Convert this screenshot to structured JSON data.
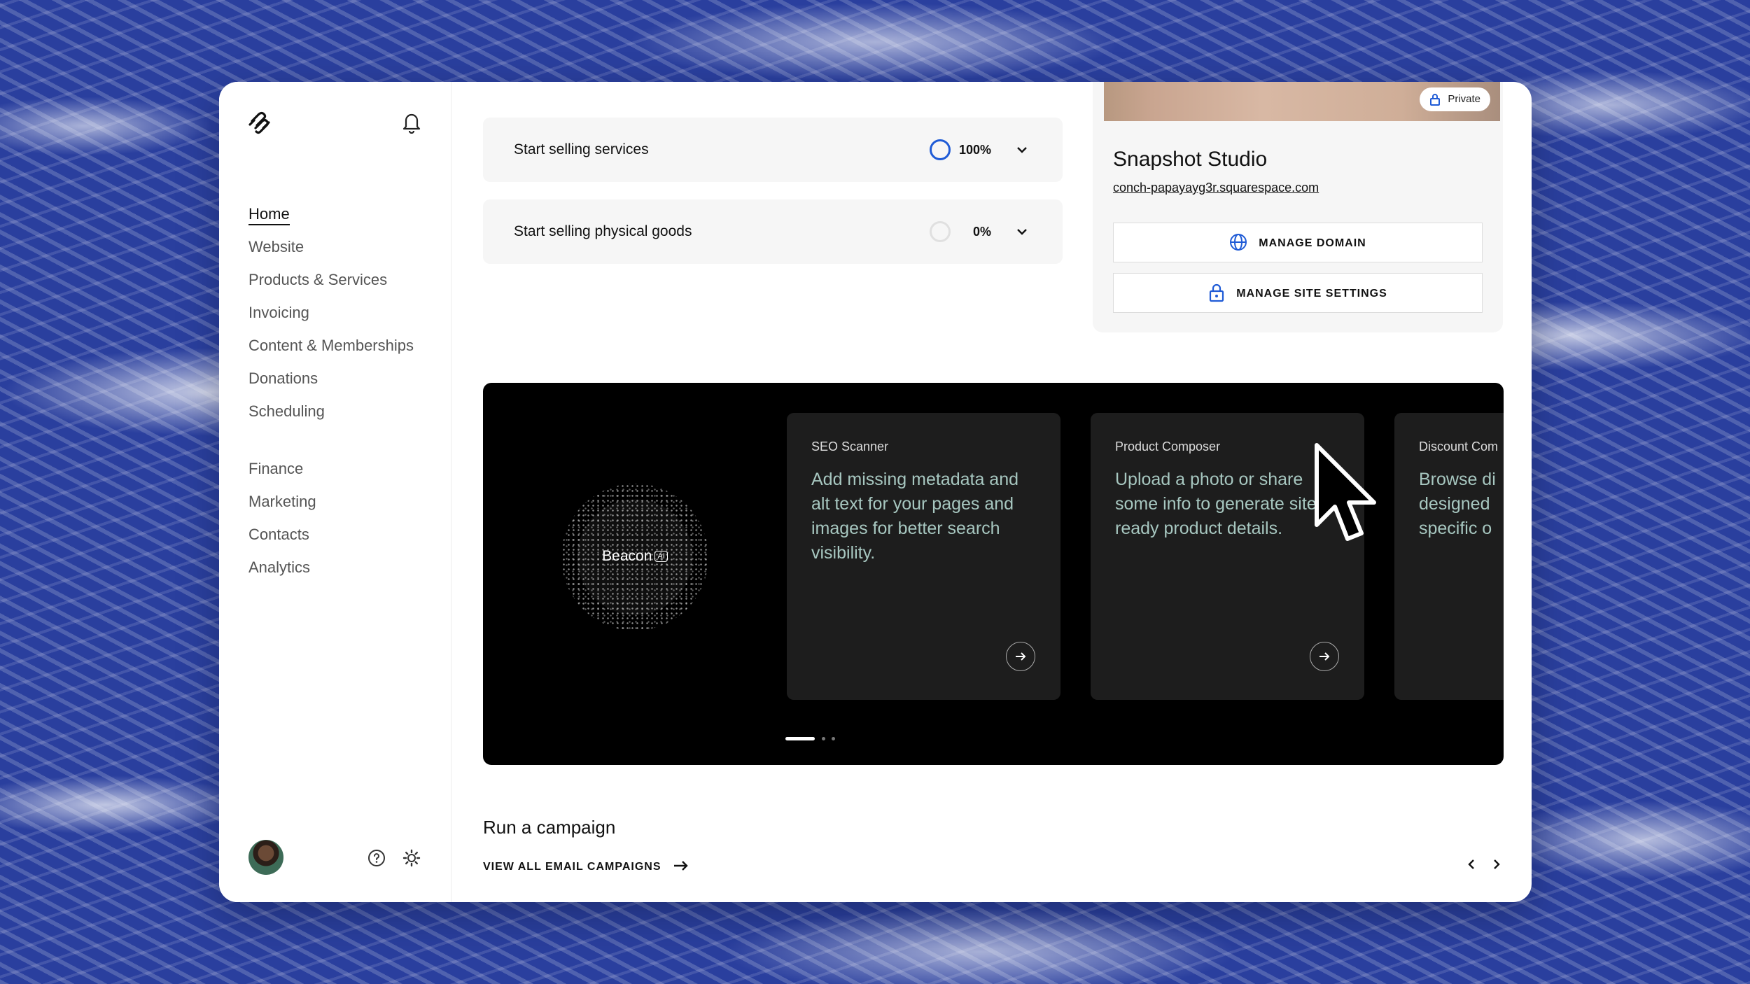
{
  "sidebar": {
    "nav": [
      {
        "label": "Home",
        "active": true
      },
      {
        "label": "Website"
      },
      {
        "label": "Products & Services"
      },
      {
        "label": "Invoicing"
      },
      {
        "label": "Content & Memberships"
      },
      {
        "label": "Donations"
      },
      {
        "label": "Scheduling"
      }
    ],
    "nav2": [
      {
        "label": "Finance"
      },
      {
        "label": "Marketing"
      },
      {
        "label": "Contacts"
      },
      {
        "label": "Analytics"
      }
    ]
  },
  "tasks": [
    {
      "label": "Start selling services",
      "percent": "100%",
      "progress": 1.0
    },
    {
      "label": "Start selling physical goods",
      "percent": "0%",
      "progress": 0.0
    }
  ],
  "site": {
    "badge": "Private",
    "title": "Snapshot Studio",
    "url": "conch-papayayg3r.squarespace.com",
    "manage_domain": "MANAGE DOMAIN",
    "manage_settings": "MANAGE SITE SETTINGS"
  },
  "ai": {
    "brand": "Beacon",
    "tag": "AI",
    "cards": [
      {
        "kicker": "SEO Scanner",
        "desc": "Add missing metadata and alt text for your pages and images for better search visibility."
      },
      {
        "kicker": "Product Composer",
        "desc": "Upload a photo or share some info to generate site-ready product details."
      },
      {
        "kicker": "Discount Com",
        "desc": "Browse di designed specific o"
      }
    ],
    "dots_count": 3,
    "active_dot": 0
  },
  "campaign": {
    "title": "Run a campaign",
    "link": "VIEW ALL EMAIL CAMPAIGNS"
  },
  "colors": {
    "accent_blue": "#1f5bd6",
    "card_text": "#a7c7c0",
    "background_blue": "#2a3f9e"
  }
}
